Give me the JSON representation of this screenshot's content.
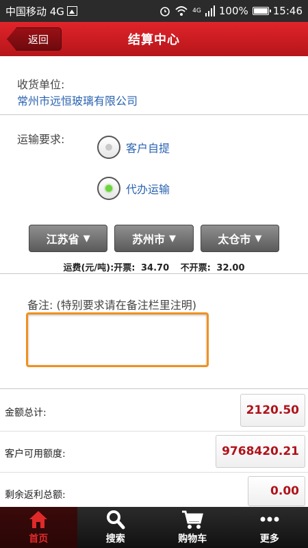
{
  "status_bar": {
    "carrier": "中国移动 4G",
    "network": "4G",
    "battery": "100%",
    "time": "15:46"
  },
  "header": {
    "back_label": "返回",
    "title": "结算中心"
  },
  "consignee": {
    "label": "收货单位:",
    "value": "常州市远恒玻璃有限公司"
  },
  "transport": {
    "label": "运输要求:",
    "options": [
      {
        "label": "客户自提",
        "checked": false
      },
      {
        "label": "代办运输",
        "checked": true
      }
    ],
    "province": "江苏省",
    "city": "苏州市",
    "district": "太仓市",
    "freight_label": "运费(元/吨):开票:",
    "invoice_value": "34.70",
    "no_invoice_label": "不开票:",
    "no_invoice_value": "32.00"
  },
  "remarks": {
    "label": "备注: (特别要求请在备注栏里注明)",
    "value": ""
  },
  "totals": {
    "amount_label": "金额总计:",
    "amount_value": "2120.50",
    "credit_label": "客户可用额度:",
    "credit_value": "9768420.21",
    "rebate_label": "剩余返利总额:",
    "rebate_value": "0.00"
  },
  "nav": {
    "home": "首页",
    "search": "搜索",
    "cart": "购物车",
    "more": "更多"
  },
  "colors": {
    "header_red": "#d01c22",
    "value_red": "#b0121a",
    "link_blue": "#2a63b0",
    "input_orange": "#f0901e"
  }
}
